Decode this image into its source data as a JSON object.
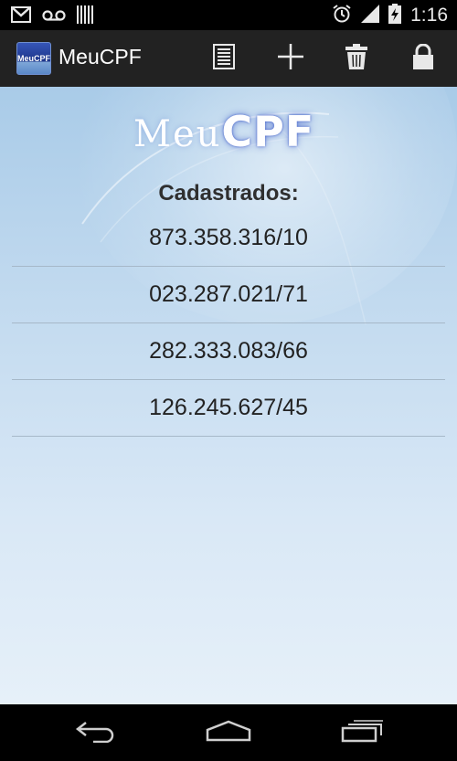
{
  "status_bar": {
    "time": "1:16",
    "icons": [
      "gmail-icon",
      "voicemail-icon",
      "barcode-icon",
      "alarm-icon",
      "signal-icon",
      "battery-icon"
    ]
  },
  "action_bar": {
    "app_name": "MeuCPF",
    "app_icon_text": "MeuCPF",
    "actions": [
      "list-icon",
      "add-icon",
      "delete-icon",
      "lock-icon"
    ]
  },
  "main": {
    "logo": {
      "part1": "Meu",
      "part2": "CPF"
    },
    "heading": "Cadastrados:",
    "items": [
      "873.358.316/10",
      "023.287.021/71",
      "282.333.083/66",
      "126.245.627/45"
    ]
  },
  "nav_bar": {
    "buttons": [
      "back-icon",
      "home-icon",
      "recent-apps-icon"
    ]
  },
  "colors": {
    "action_bar_bg": "#222222",
    "content_top": "#a9cbe8",
    "content_bottom": "#e6f0f9",
    "divider": "#a6b8c8"
  }
}
